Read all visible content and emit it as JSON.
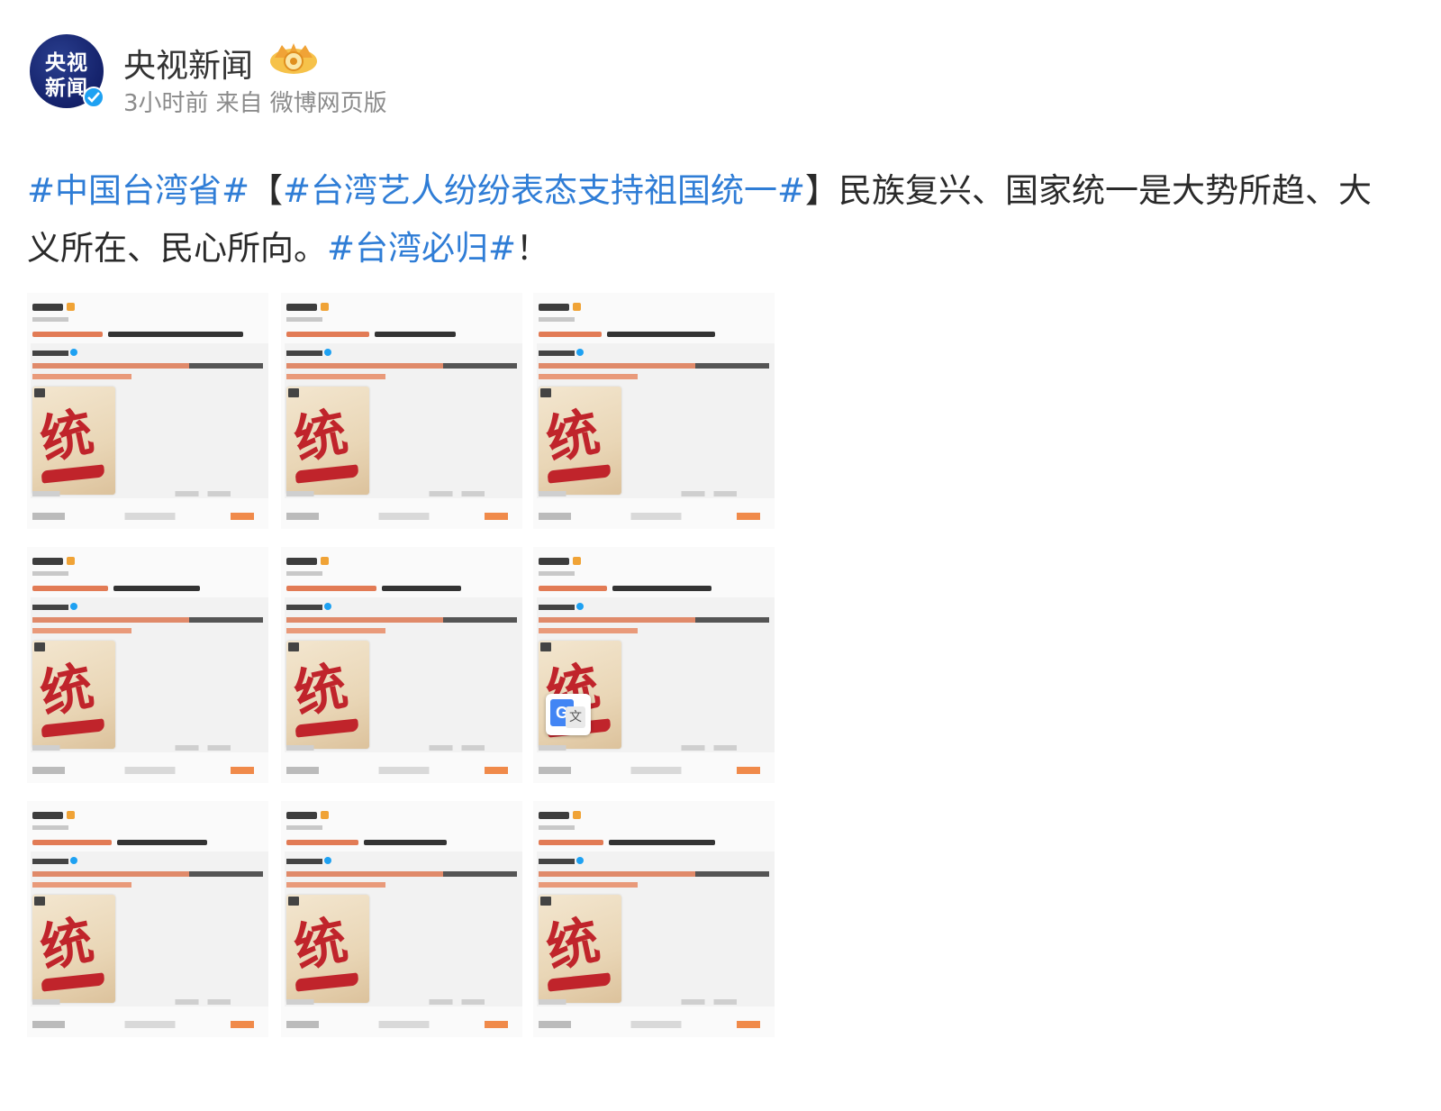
{
  "header": {
    "avatar_line1": "央视",
    "avatar_line2": "新闻",
    "name": "央视新闻",
    "time": "3小时前",
    "source_prefix": "来自",
    "source": "微博网页版"
  },
  "post": {
    "tag1": "#中国台湾省#",
    "bracket_open": "【",
    "tag2": "#台湾艺人纷纷表态支持祖国统一#",
    "bracket_close": "】",
    "body": "民族复兴、国家统一是大势所趋、大义所在、民心所向。",
    "tag3": "#台湾必归#",
    "ending": "！"
  },
  "grid": {
    "poster_char": "统",
    "cards": 9
  },
  "translate": {
    "g_label": "G",
    "x_label": "文"
  },
  "colors": {
    "link": "#2f7dd6",
    "meta": "#8b8b8b",
    "poster_red": "#c0242b",
    "verified": "#1ea1f2"
  },
  "icons": [
    "verified-icon",
    "vip-crown-icon",
    "google-translate-icon"
  ]
}
